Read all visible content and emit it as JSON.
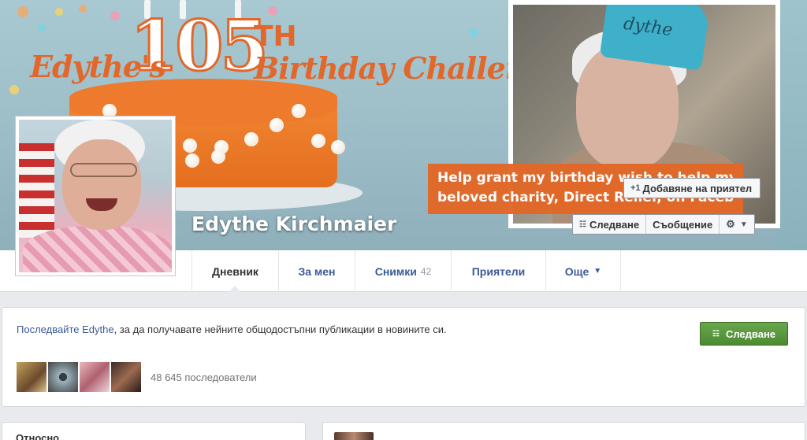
{
  "cover": {
    "title_part1": "Edythe's",
    "title_number": "105",
    "title_suffix": "TH",
    "title_part2": "Birthday Challenge",
    "photo_hat_text": "dythe",
    "banner_line1": "Help grant my birthday wish to help my",
    "banner_line2": "beloved charity, Direct Relief, on Facebook."
  },
  "profile": {
    "name": "Edythe Kirchmaier"
  },
  "actions": {
    "add_friend": "Добавяне на приятел",
    "follow": "Следване",
    "message": "Съобщение"
  },
  "nav": {
    "tabs": [
      {
        "label": "Дневник"
      },
      {
        "label": "За мен"
      },
      {
        "label": "Снимки",
        "count": "42"
      },
      {
        "label": "Приятели"
      },
      {
        "label": "Още"
      }
    ]
  },
  "follow_box": {
    "link_text": "Последвайте Edythe",
    "text": ", за да получавате нейните общодостъпни публикации в новините си.",
    "button": "Следване",
    "followers": "48 645 последователи"
  },
  "bottom": {
    "left_title": "Относно"
  },
  "colors": {
    "accent_orange": "#e2672b",
    "link_blue": "#3b5998",
    "follow_green": "#4c8b33"
  }
}
